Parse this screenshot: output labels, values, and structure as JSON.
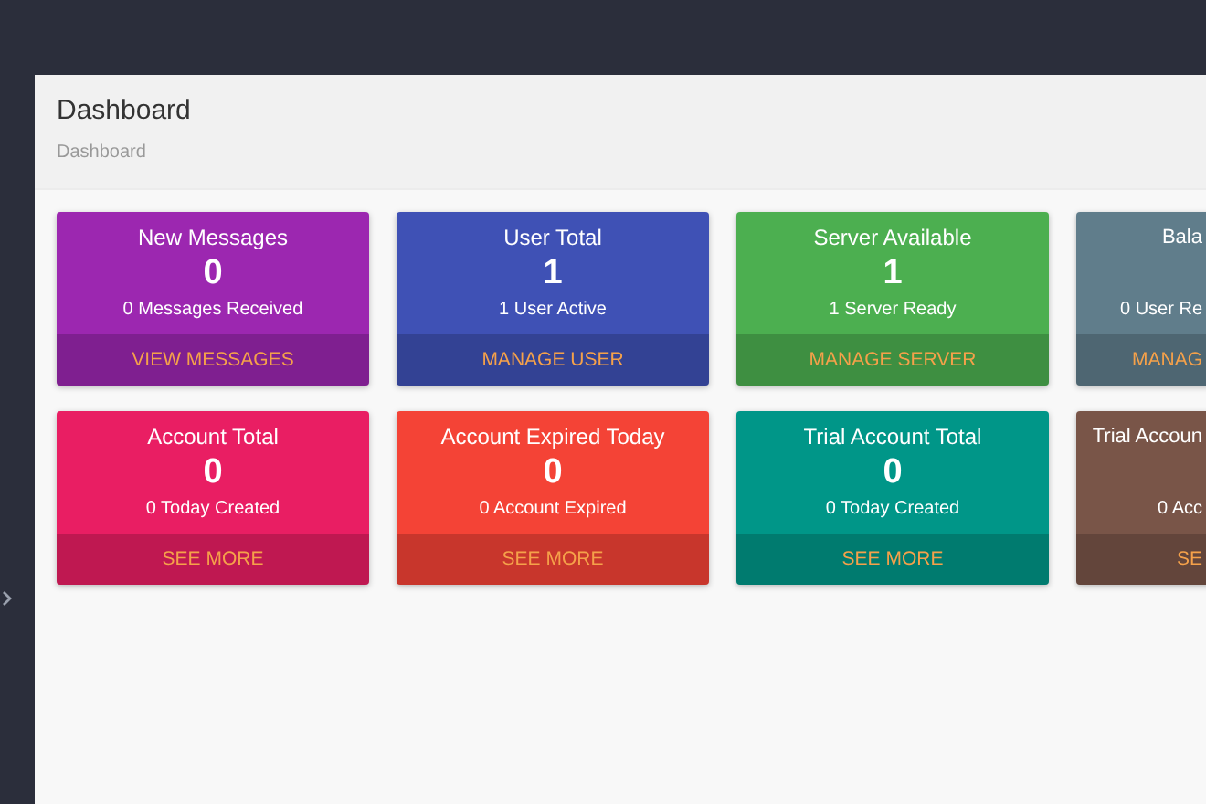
{
  "page": {
    "title": "Dashboard",
    "breadcrumb": "Dashboard"
  },
  "card_rows": [
    [
      {
        "kind": "full",
        "color": "#9c27b0",
        "title": "New Messages",
        "value": "0",
        "subtitle": "0 Messages Received",
        "action": "VIEW MESSAGES"
      },
      {
        "kind": "full",
        "color": "#3f51b5",
        "title": "User Total",
        "value": "1",
        "subtitle": "1 User Active",
        "action": "MANAGE USER"
      },
      {
        "kind": "full",
        "color": "#4caf50",
        "title": "Server Available",
        "value": "1",
        "subtitle": "1 Server Ready",
        "action": "MANAGE SERVER"
      },
      {
        "kind": "partial",
        "color": "#607d8b",
        "title": "Bala",
        "subtitle": "0 User Re",
        "action": "MANAG"
      }
    ],
    [
      {
        "kind": "full",
        "color": "#e91e63",
        "title": "Account Total",
        "value": "0",
        "subtitle": "0 Today Created",
        "action": "SEE MORE"
      },
      {
        "kind": "full",
        "color": "#f44336",
        "title": "Account Expired Today",
        "value": "0",
        "subtitle": "0 Account Expired",
        "action": "SEE MORE"
      },
      {
        "kind": "full",
        "color": "#009688",
        "title": "Trial Account Total",
        "value": "0",
        "subtitle": "0 Today Created",
        "action": "SEE MORE"
      },
      {
        "kind": "partial",
        "color": "#795548",
        "title": "Trial Accoun",
        "subtitle": "0 Acc",
        "action": "SE"
      }
    ]
  ]
}
